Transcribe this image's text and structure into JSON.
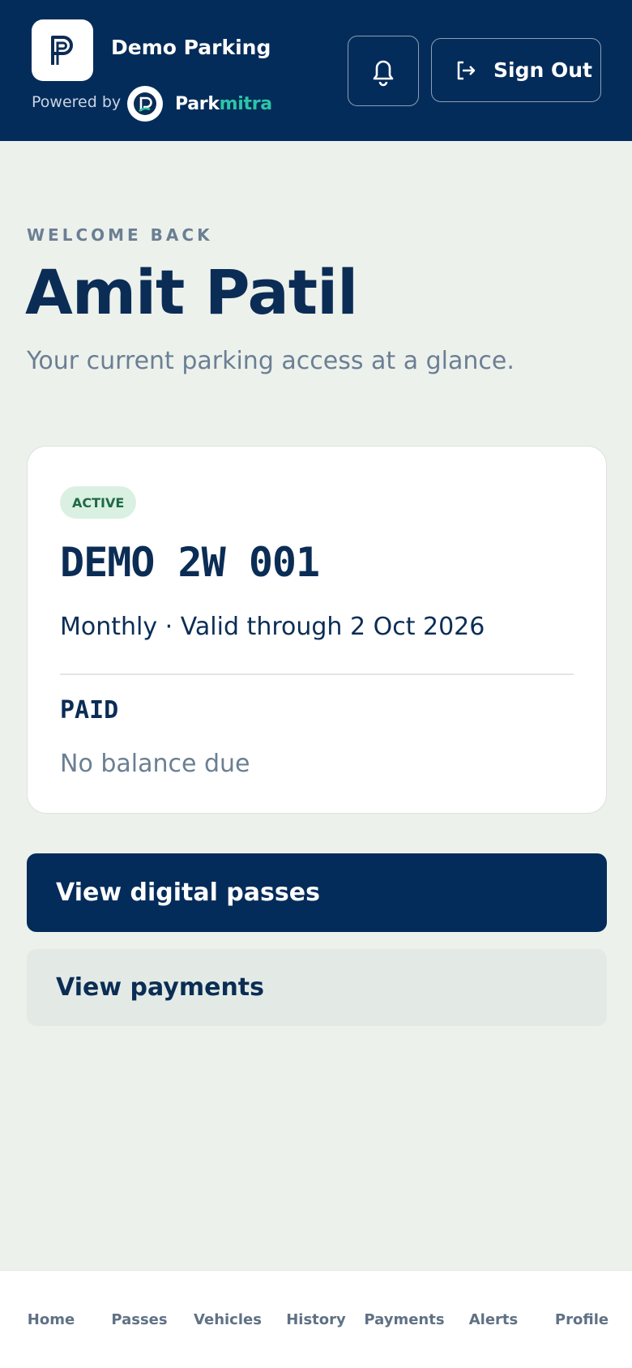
{
  "header": {
    "app_name": "Demo Parking",
    "powered_by": "Powered by",
    "brand_part1": "Park",
    "brand_part2": "mitra",
    "notifications_icon": "bell-icon",
    "sign_out_label": "Sign Out",
    "sign_out_icon": "sign-out-icon"
  },
  "welcome": {
    "eyebrow": "WELCOME BACK",
    "name": "Amit Patil",
    "subtitle": "Your current parking access at a glance."
  },
  "pass": {
    "status": "ACTIVE",
    "vehicle_number": "DEMO 2W 001",
    "validity": "Monthly · Valid through 2 Oct 2026",
    "payment_status": "PAID",
    "balance_text": "No balance due"
  },
  "actions": {
    "primary_label": "View digital passes",
    "secondary_label": "View payments"
  },
  "nav": {
    "items": [
      {
        "label": "Home"
      },
      {
        "label": "Passes"
      },
      {
        "label": "Vehicles"
      },
      {
        "label": "History"
      },
      {
        "label": "Payments"
      },
      {
        "label": "Alerts"
      },
      {
        "label": "Profile"
      }
    ]
  },
  "colors": {
    "brand_navy": "#042c5a",
    "accent_teal": "#2cc5a6",
    "background": "#edf1ec",
    "active_badge_bg": "#daf0e3",
    "active_badge_text": "#1f6a45"
  }
}
